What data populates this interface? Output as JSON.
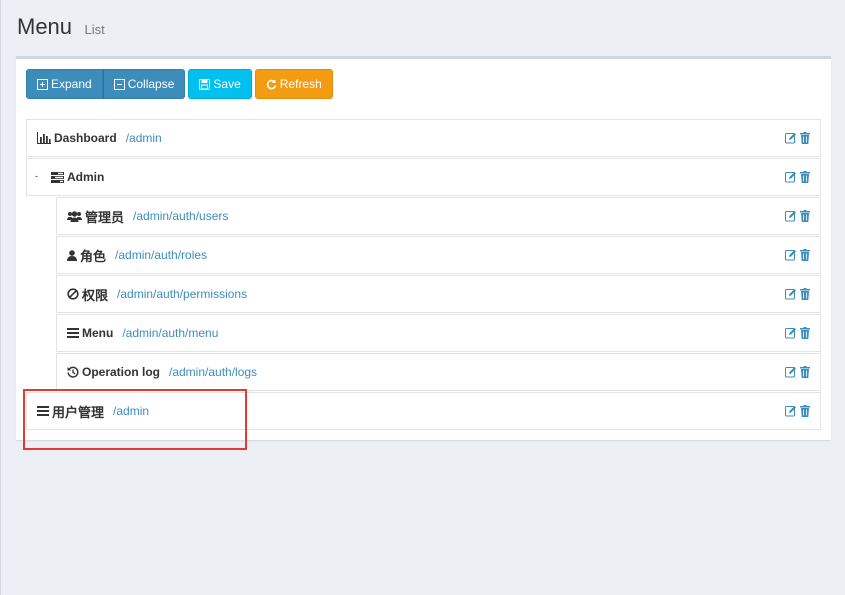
{
  "header": {
    "title": "Menu",
    "subtitle": "List"
  },
  "toolbar": {
    "expand_label": "Expand",
    "collapse_label": "Collapse",
    "save_label": "Save",
    "refresh_label": "Refresh"
  },
  "tree": {
    "collapse_toggle": "-",
    "items": [
      {
        "icon": "bar-chart-icon",
        "title": "Dashboard",
        "path": "/admin"
      },
      {
        "icon": "tasks-icon",
        "title": "Admin",
        "path": ""
      },
      {
        "icon": "users-icon",
        "title": "管理员",
        "path": "/admin/auth/users"
      },
      {
        "icon": "user-icon",
        "title": "角色",
        "path": "/admin/auth/roles"
      },
      {
        "icon": "ban-icon",
        "title": "权限",
        "path": "/admin/auth/permissions"
      },
      {
        "icon": "bars-icon",
        "title": "Menu",
        "path": "/admin/auth/menu"
      },
      {
        "icon": "history-icon",
        "title": "Operation log",
        "path": "/admin/auth/logs"
      },
      {
        "icon": "bars-icon",
        "title": "用户管理",
        "path": "/admin"
      }
    ]
  },
  "colors": {
    "primary": "#3c8dbc",
    "info": "#00c0ef",
    "warning": "#f39c12",
    "highlight": "#e53935",
    "background": "#ecf0f5"
  }
}
